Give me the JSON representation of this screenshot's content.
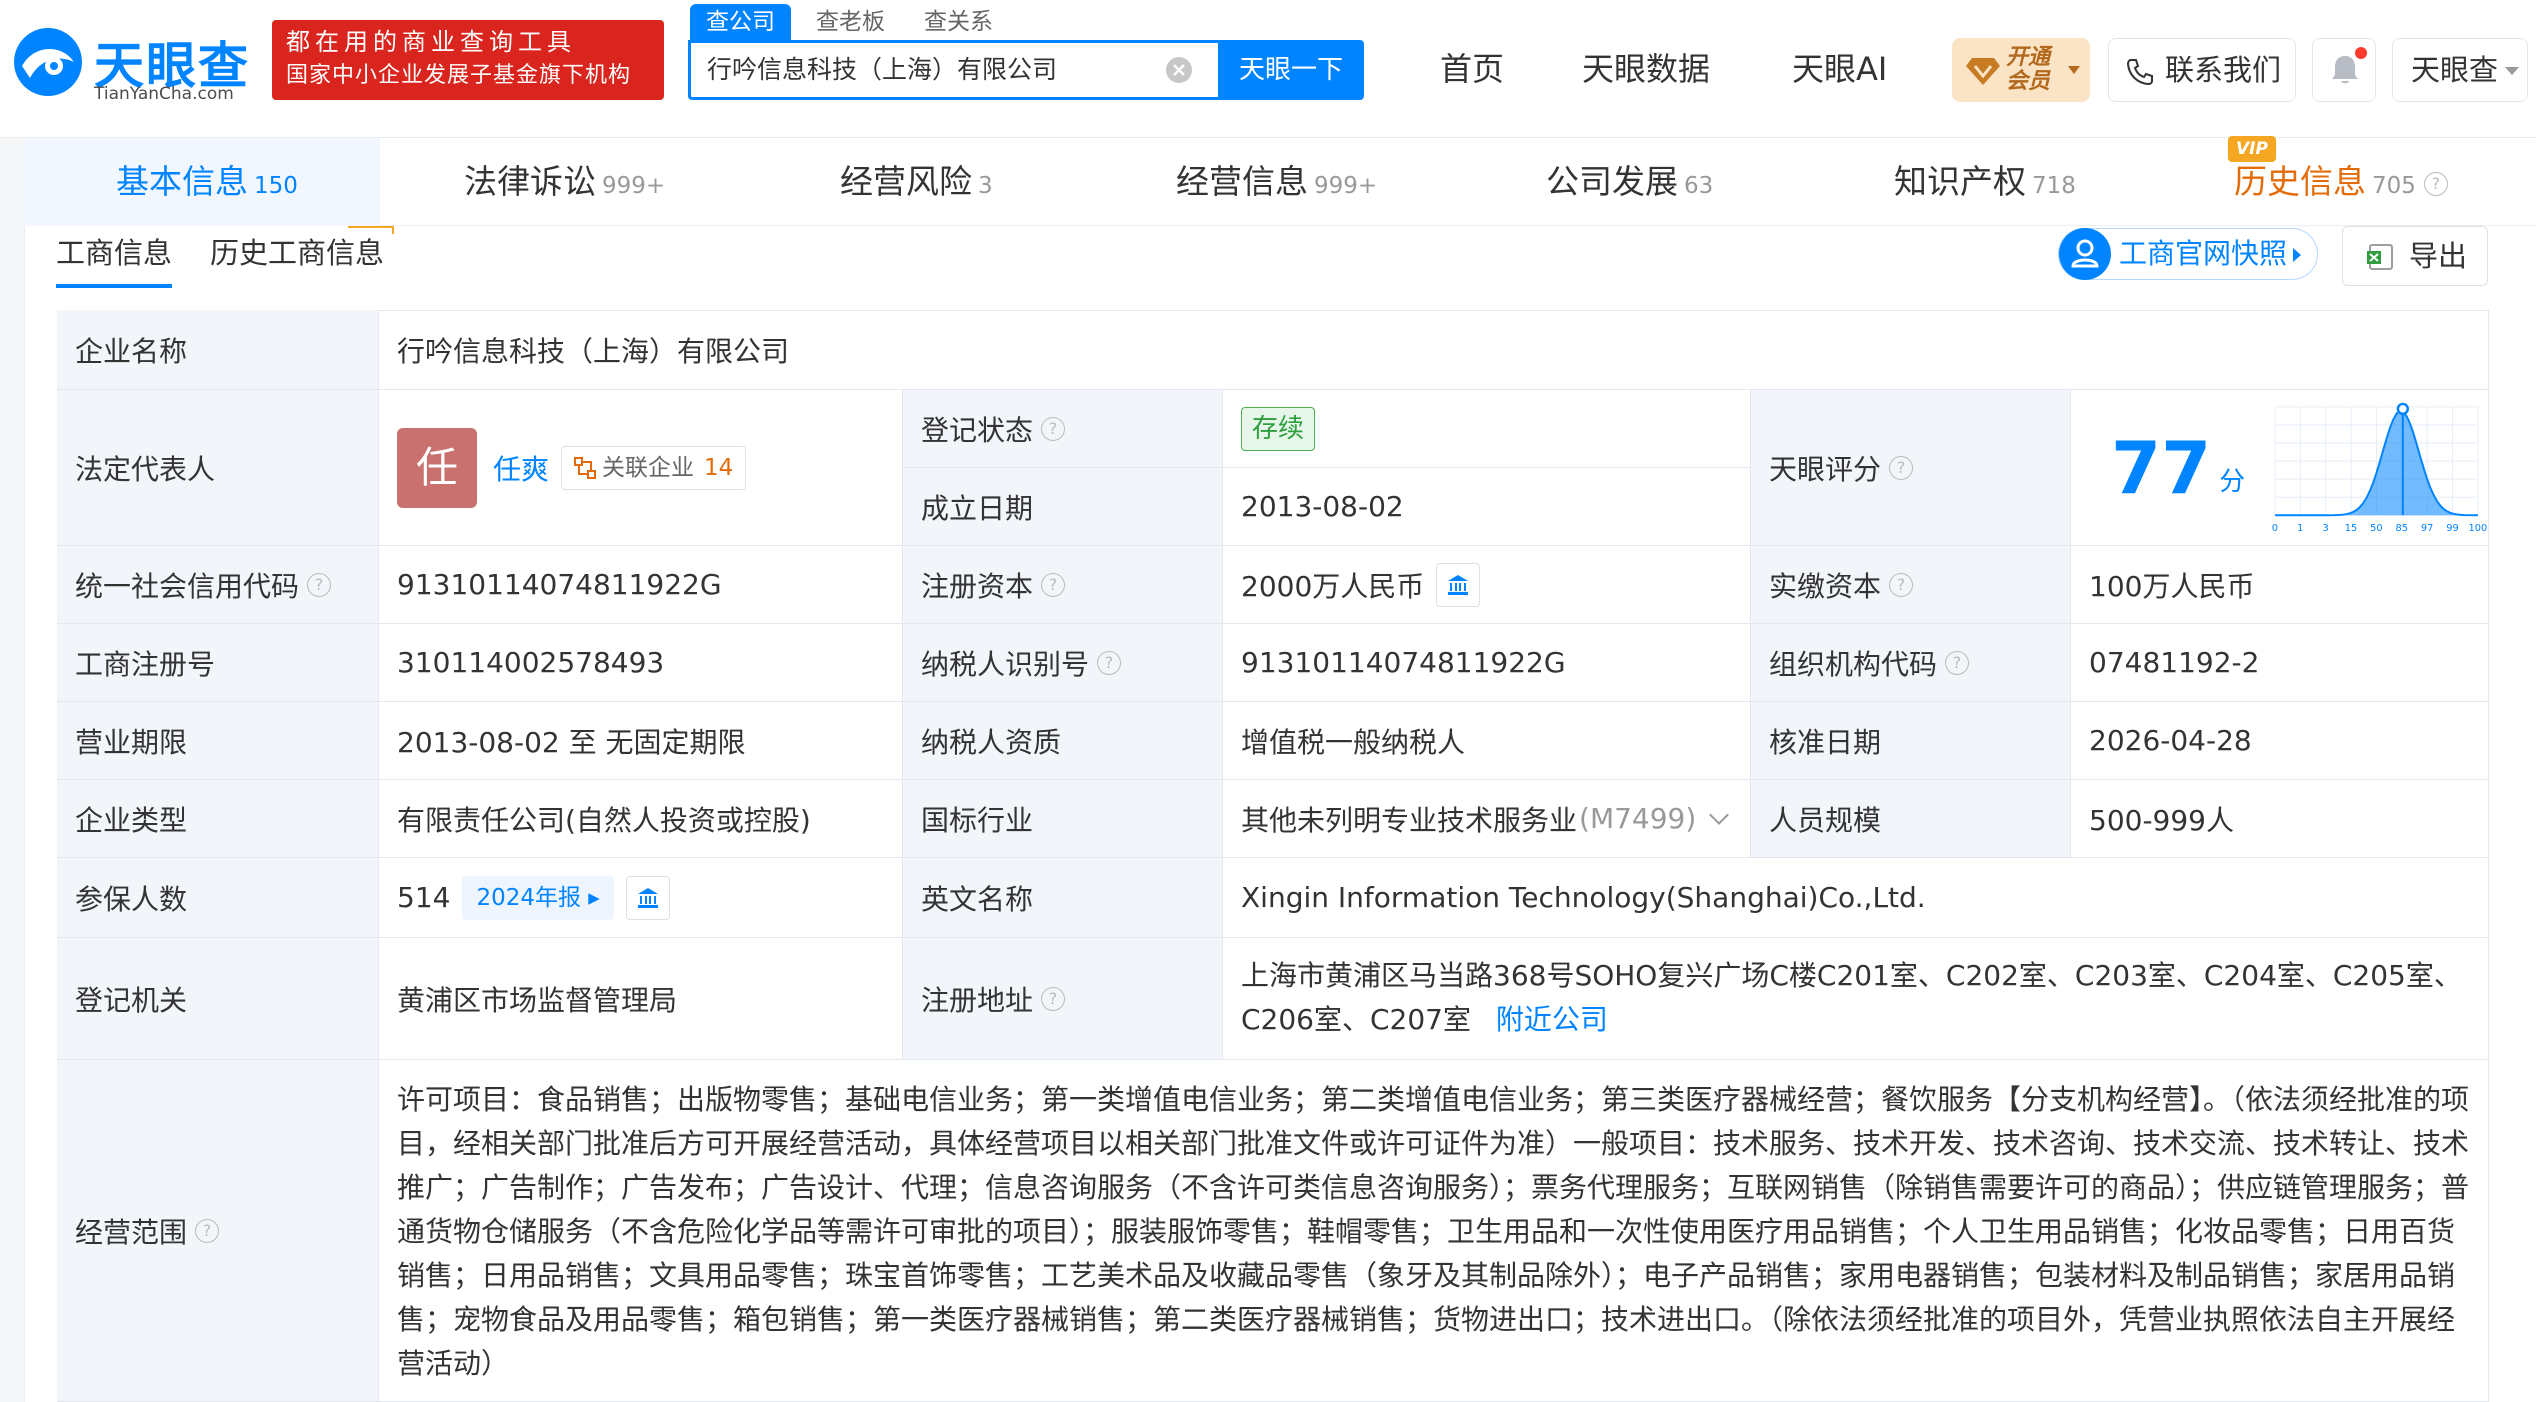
{
  "brand": {
    "name_cn": "天眼查",
    "name_en": "TianYanCha.com"
  },
  "banner": {
    "line1": "都在用的商业查询工具",
    "line2": "国家中小企业发展子基金旗下机构"
  },
  "search": {
    "tabs": [
      "查公司",
      "查老板",
      "查关系"
    ],
    "query": "行吟信息科技（上海）有限公司",
    "button": "天眼一下"
  },
  "nav": {
    "items": [
      "首页",
      "天眼数据",
      "天眼AI"
    ]
  },
  "header": {
    "vip_label": "开通会员",
    "contact": "联系我们",
    "user": "天眼查"
  },
  "main_tabs": [
    {
      "label": "基本信息",
      "count": "150"
    },
    {
      "label": "法律诉讼",
      "count": "999+"
    },
    {
      "label": "经营风险",
      "count": "3"
    },
    {
      "label": "经营信息",
      "count": "999+"
    },
    {
      "label": "公司发展",
      "count": "63"
    },
    {
      "label": "知识产权",
      "count": "718"
    },
    {
      "label": "历史信息",
      "count": "705",
      "badge": "VIP"
    }
  ],
  "sub_tabs": [
    "工商信息",
    "历史工商信息"
  ],
  "actions": {
    "snapshot": "工商官网快照",
    "export": "导出"
  },
  "info": {
    "company_name": {
      "label": "企业名称",
      "value": "行吟信息科技（上海）有限公司"
    },
    "legal_rep": {
      "label": "法定代表人",
      "avatar_char": "任",
      "name": "任爽",
      "related_label": "关联企业",
      "related_count": "14"
    },
    "reg_status": {
      "label": "登记状态",
      "value": "存续"
    },
    "founded": {
      "label": "成立日期",
      "value": "2013-08-02"
    },
    "score": {
      "label": "天眼评分",
      "value": "77",
      "unit": "分",
      "axis": [
        "0",
        "1",
        "3",
        "15",
        "50",
        "85",
        "97",
        "99",
        "100"
      ],
      "color": "#0084ff"
    },
    "credit_code": {
      "label": "统一社会信用代码",
      "value": "91310114074811922G"
    },
    "reg_capital": {
      "label": "注册资本",
      "value": "2000万人民币"
    },
    "paid_capital": {
      "label": "实缴资本",
      "value": "100万人民币"
    },
    "reg_number": {
      "label": "工商注册号",
      "value": "310114002578493"
    },
    "taxpayer_id": {
      "label": "纳税人识别号",
      "value": "91310114074811922G"
    },
    "org_code": {
      "label": "组织机构代码",
      "value": "07481192-2"
    },
    "term": {
      "label": "营业期限",
      "value": "2013-08-02 至 无固定期限"
    },
    "taxpayer_qual": {
      "label": "纳税人资质",
      "value": "增值税一般纳税人"
    },
    "approval_date": {
      "label": "核准日期",
      "value": "2026-04-28"
    },
    "company_type": {
      "label": "企业类型",
      "value": "有限责任公司(自然人投资或控股)"
    },
    "industry": {
      "label": "国标行业",
      "value": "其他未列明专业技术服务业",
      "code": "(M7499)"
    },
    "staff_size": {
      "label": "人员规模",
      "value": "500-999人"
    },
    "insured": {
      "label": "参保人数",
      "value": "514",
      "report": "2024年报"
    },
    "english_name": {
      "label": "英文名称",
      "value": "Xingin Information Technology(Shanghai)Co.,Ltd."
    },
    "reg_authority": {
      "label": "登记机关",
      "value": "黄浦区市场监督管理局"
    },
    "reg_address": {
      "label": "注册地址",
      "value": "上海市黄浦区马当路368号SOHO复兴广场C楼C201室、C202室、C203室、C204室、C205室、C206室、C207室",
      "nearby": "附近公司"
    },
    "scope": {
      "label": "经营范围",
      "value": "许可项目：食品销售；出版物零售；基础电信业务；第一类增值电信业务；第二类增值电信业务；第三类医疗器械经营；餐饮服务【分支机构经营】。（依法须经批准的项目，经相关部门批准后方可开展经营活动，具体经营项目以相关部门批准文件或许可证件为准）一般项目：技术服务、技术开发、技术咨询、技术交流、技术转让、技术推广；广告制作；广告发布；广告设计、代理；信息咨询服务（不含许可类信息咨询服务）；票务代理服务；互联网销售（除销售需要许可的商品）；供应链管理服务；普通货物仓储服务（不含危险化学品等需许可审批的项目）；服装服饰零售；鞋帽零售；卫生用品和一次性使用医疗用品销售；个人卫生用品销售；化妆品零售；日用百货销售；日用品销售；文具用品零售；珠宝首饰零售；工艺美术品及收藏品零售（象牙及其制品除外）；电子产品销售；家用电器销售；包装材料及制品销售；家居用品销售；宠物食品及用品零售；箱包销售；第一类医疗器械销售；第二类医疗器械销售；货物进出口；技术进出口。（除依法须经批准的项目外，凭营业执照依法自主开展经营活动）"
    }
  }
}
